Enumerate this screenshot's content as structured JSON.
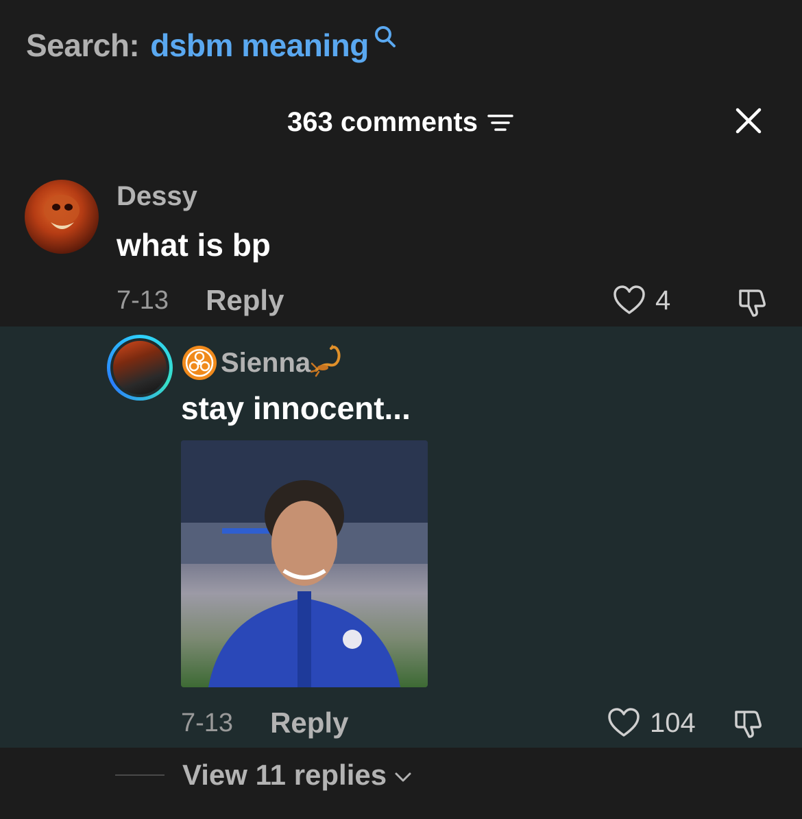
{
  "search": {
    "prefix": "Search:",
    "term": "dsbm meaning"
  },
  "header": {
    "count_label": "363 comments"
  },
  "comments": [
    {
      "username": "Dessy",
      "text": "what is bp",
      "date": "7-13",
      "reply_label": "Reply",
      "likes": "4"
    },
    {
      "username": "Sienna",
      "text": "stay innocent...",
      "date": "7-13",
      "reply_label": "Reply",
      "likes": "104",
      "has_image": true
    }
  ],
  "view_replies": {
    "label": "View 11 replies"
  },
  "colors": {
    "background": "#1c1c1c",
    "reply_highlight": "#1f2c2e",
    "search_term": "#5aa8f0"
  }
}
